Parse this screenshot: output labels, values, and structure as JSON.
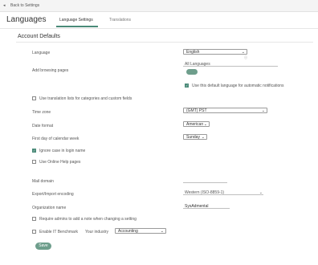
{
  "topbar": {
    "back_label": "Back to Settings"
  },
  "header": {
    "title": "Languages",
    "tabs": [
      {
        "label": "Language Settings",
        "active": true
      },
      {
        "label": "Translations",
        "active": false
      }
    ]
  },
  "section": {
    "title": "Account Defaults"
  },
  "form": {
    "language": {
      "label": "Language",
      "value": "English"
    },
    "add_browsing": {
      "label": "Add browsing pages",
      "input_value": "All Languages"
    },
    "use_default_notifications": {
      "label": "Use this default language for automatic notifications",
      "checked": true
    },
    "translate_categories": {
      "label": "Use translation lists for categories and custom fields",
      "checked": false
    },
    "timezone": {
      "label": "Time zone",
      "value": "(GMT) PST"
    },
    "date_format": {
      "label": "Date format",
      "value": "American"
    },
    "first_day": {
      "label": "First day of calendar week",
      "value": "Sunday"
    },
    "ignore_case": {
      "label": "Ignore case in login name",
      "checked": true
    },
    "online_help": {
      "label": "Use Online Help pages",
      "checked": false
    },
    "mail_domain": {
      "label": "Mail domain",
      "value": ""
    },
    "export_encoding": {
      "label": "Export/Import encoding",
      "value": "Western (ISO-8859-1)"
    },
    "org_name": {
      "label": "Organization name",
      "value": "SysAdmental"
    },
    "require_notes": {
      "label": "Require admins to add a note when changing a setting",
      "checked": false
    },
    "benchmark": {
      "label": "Enable IT Benchmark",
      "industry_label": "Your industry",
      "industry_value": "Accounting",
      "checked": false
    }
  },
  "actions": {
    "save_label": "Save"
  },
  "colors": {
    "accent": "#4a8a78",
    "toggle": "#6e9e8c"
  }
}
